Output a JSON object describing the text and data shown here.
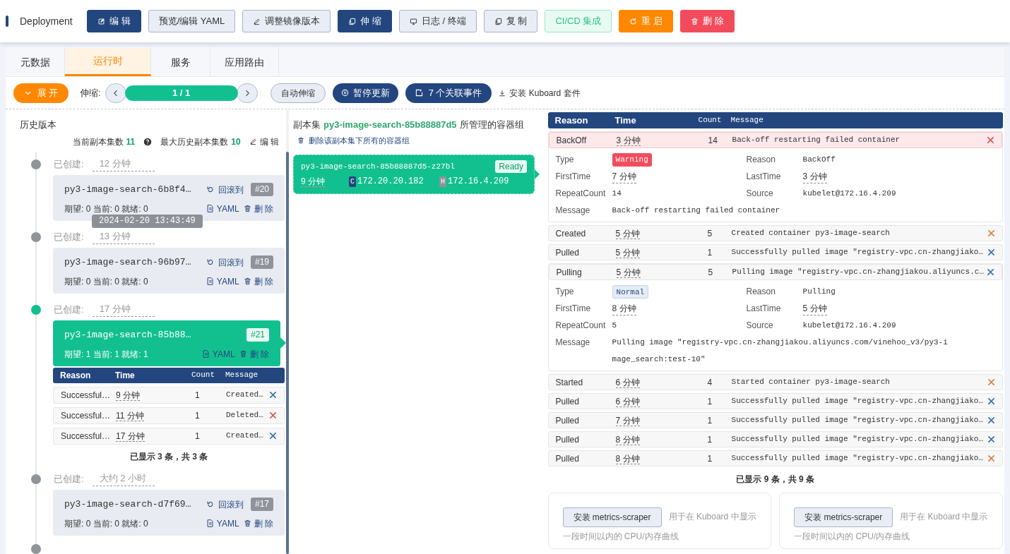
{
  "header": {
    "title": "Deployment",
    "buttons": [
      {
        "label": "编 辑",
        "kind": "primary"
      },
      {
        "label": "预览/编辑 YAML",
        "kind": "outline"
      },
      {
        "label": "调整镜像版本",
        "kind": "outline"
      },
      {
        "label": "伸 缩",
        "kind": "primary"
      },
      {
        "label": "日志 / 终端",
        "kind": "outline"
      },
      {
        "label": "复 制",
        "kind": "outline"
      },
      {
        "label": "CI/CD 集成",
        "kind": "success"
      },
      {
        "label": "重 启",
        "kind": "warning"
      },
      {
        "label": "删 除",
        "kind": "danger"
      }
    ]
  },
  "tabs": [
    {
      "label": "元数据",
      "selected": false
    },
    {
      "label": "运行时",
      "selected": true
    },
    {
      "label": "服务",
      "selected": false
    },
    {
      "label": "应用路由",
      "selected": false
    }
  ],
  "toolbar": {
    "expand": "展 开",
    "scale_label": "伸缩:",
    "scale_value": "1 / 1",
    "level": 1,
    "auto_scale": "自动伸缩",
    "pause": "暂停更新",
    "events": "7 个关联事件",
    "install": "安装 Kuboard 套件"
  },
  "history": {
    "title": "历史版本",
    "current_label": "当前副本集数",
    "current_count": "11",
    "max_label": "最大历史副本集数",
    "max_count": "10",
    "edit": "编 辑",
    "versions": [
      {
        "created_label": "已创建:",
        "created": "12 分钟",
        "name": "py3-image-search-6b8f4…",
        "revision": "#20",
        "stats": "期望: 0 当前: 0 就绪: 0",
        "selected": false,
        "rollback": "回滚到",
        "yaml": "YAML",
        "delete": "删 除",
        "tooltip": "2024-02-20 13:43:49"
      },
      {
        "created_label": "已创建:",
        "created": "13 分钟",
        "name": "py3-image-search-96b97…",
        "revision": "#19",
        "stats": "期望: 0 当前: 0 就绪: 0",
        "selected": false,
        "rollback": "回滚到",
        "yaml": "YAML",
        "delete": "删 除"
      },
      {
        "created_label": "已创建:",
        "created": "17 分钟",
        "name": "py3-image-search-85b88…",
        "revision": "#21",
        "stats": "期望: 1 当前: 1 就绪: 1",
        "selected": true,
        "yaml": "YAML",
        "delete": "删 除",
        "events": {
          "columns": [
            "Reason",
            "Time",
            "Count",
            "Message"
          ],
          "rows": [
            {
              "reason": "Successful…",
              "time": "9 分钟",
              "count": "1",
              "message": "Created…",
              "color": "#2f6fb3"
            },
            {
              "reason": "Successful…",
              "time": "11 分钟",
              "count": "1",
              "message": "Deleted…",
              "color": "#d9534f"
            },
            {
              "reason": "Successful…",
              "time": "17 分钟",
              "count": "1",
              "message": "Created…",
              "color": "#2f6fb3"
            }
          ],
          "footer": "已显示 3 条，共 3 条"
        }
      },
      {
        "created_label": "已创建:",
        "created": "大约 2 小时",
        "name": "py3-image-search-d7f69…",
        "revision": "#17",
        "stats": "期望: 0 当前: 0 就绪: 0",
        "selected": false,
        "rollback": "回滚到",
        "yaml": "YAML",
        "delete": "删 除"
      }
    ]
  },
  "pods": {
    "title_prefix": "副本集",
    "replicaset": "py3-image-search-85b88887d5",
    "title_suffix": "所管理的容器组",
    "delete_all": "删除该副本集下所有的容器组",
    "items": [
      {
        "name": "py3-image-search-85b88887d5-z27bl",
        "status": "Ready",
        "age": "9 分钟",
        "container_badge": "C",
        "container_ip": "172.20.20.182",
        "host_badge": "H",
        "host_ip": "172.16.4.209"
      }
    ]
  },
  "events": {
    "columns": [
      "Reason",
      "Time",
      "Count",
      "Message"
    ],
    "rows": [
      {
        "reason": "BackOff",
        "time": "3 分钟",
        "count": "14",
        "message": "Back-off restarting failed container",
        "kind": "warning",
        "color": "#d9534f",
        "expanded": true,
        "details": {
          "type_label": "Type",
          "type": "Warning",
          "reason_label": "Reason",
          "reason": "BackOff",
          "first_label": "FirstTime",
          "first": "7 分钟",
          "last_label": "LastTime",
          "last": "3 分钟",
          "repeat_label": "RepeatCount",
          "repeat": "14",
          "source_label": "Source",
          "source": "kubelet@172.16.4.209",
          "message_label": "Message",
          "message": "Back-off restarting failed container"
        }
      },
      {
        "reason": "Created",
        "time": "5 分钟",
        "count": "5",
        "message": "Created container py3-image-search",
        "kind": "normal",
        "color": "#e07b39",
        "expanded": false
      },
      {
        "reason": "Pulled",
        "time": "5 分钟",
        "count": "1",
        "message": "Successfully pulled image \"registry-vpc.cn-zhangjiako…",
        "kind": "normal",
        "color": "#2f6fb3",
        "expanded": false
      },
      {
        "reason": "Pulling",
        "time": "5 分钟",
        "count": "5",
        "message": "Pulling image \"registry-vpc.cn-zhangjiakou.aliyuncs.c…",
        "kind": "normal",
        "color": "#2f6fb3",
        "expanded": true,
        "details": {
          "type_label": "Type",
          "type": "Normal",
          "reason_label": "Reason",
          "reason": "Pulling",
          "first_label": "FirstTime",
          "first": "8 分钟",
          "last_label": "LastTime",
          "last": "5 分钟",
          "repeat_label": "RepeatCount",
          "repeat": "5",
          "source_label": "Source",
          "source": "kubelet@172.16.4.209",
          "message_label": "Message",
          "message": "Pulling image \"registry-vpc.cn-zhangjiakou.aliyuncs.com/vinehoo_v3/py3-image_search:test-10\""
        }
      },
      {
        "reason": "Started",
        "time": "6 分钟",
        "count": "4",
        "message": "Started container py3-image-search",
        "kind": "normal",
        "color": "#e07b39",
        "expanded": false
      },
      {
        "reason": "Pulled",
        "time": "6 分钟",
        "count": "1",
        "message": "Successfully pulled image \"registry-vpc.cn-zhangjiako…",
        "kind": "normal",
        "color": "#2f6fb3",
        "expanded": false
      },
      {
        "reason": "Pulled",
        "time": "7 分钟",
        "count": "1",
        "message": "Successfully pulled image \"registry-vpc.cn-zhangjiako…",
        "kind": "normal",
        "color": "#2f6fb3",
        "expanded": false
      },
      {
        "reason": "Pulled",
        "time": "8 分钟",
        "count": "1",
        "message": "Successfully pulled image \"registry-vpc.cn-zhangjiako…",
        "kind": "normal",
        "color": "#2f6fb3",
        "expanded": false
      },
      {
        "reason": "Pulled",
        "time": "8 分钟",
        "count": "1",
        "message": "Successfully pulled image \"registry-vpc.cn-zhangjiako…",
        "kind": "normal",
        "color": "#e07b39",
        "expanded": false
      }
    ],
    "footer": "已显示 9 条，共 9 条"
  },
  "metrics": [
    {
      "button": "安装 metrics-scraper",
      "text": "用于在 Kuboard 中显示一段时间以内的 CPU/内存曲线"
    },
    {
      "button": "安装 metrics-scraper",
      "text": "用于在 Kuboard 中显示一段时间以内的 CPU/内存曲线"
    }
  ]
}
